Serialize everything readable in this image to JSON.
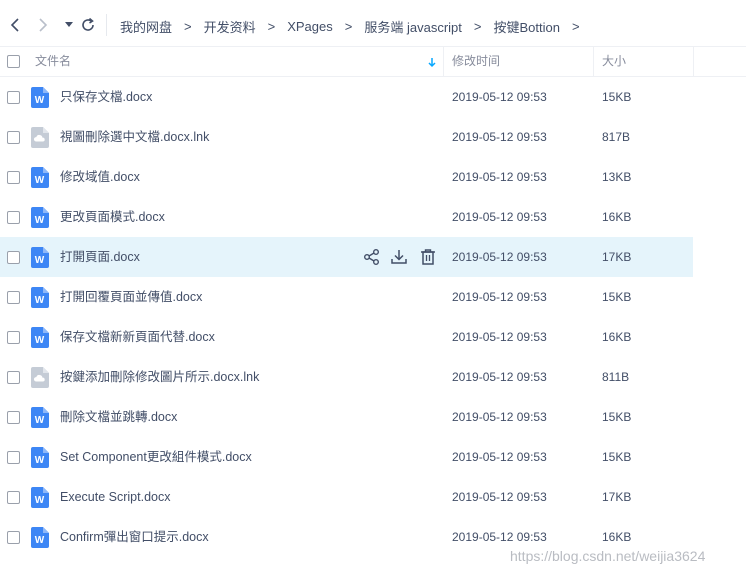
{
  "breadcrumb": {
    "items": [
      "我的网盘",
      "开发资料",
      "XPages",
      "服务端 javascript",
      "按键Bottion"
    ],
    "arrow": ">"
  },
  "table": {
    "headers": {
      "name": "文件名",
      "modified": "修改时间",
      "size": "大小"
    },
    "rows": [
      {
        "name": "只保存文檔.docx",
        "date": "2019-05-12 09:53",
        "size": "15KB",
        "icon": "word-doc-icon"
      },
      {
        "name": "視圖刪除選中文檔.docx.lnk",
        "date": "2019-05-12 09:53",
        "size": "817B",
        "icon": "cloud-file-icon"
      },
      {
        "name": "修改域值.docx",
        "date": "2019-05-12 09:53",
        "size": "13KB",
        "icon": "word-doc-icon"
      },
      {
        "name": "更改頁面模式.docx",
        "date": "2019-05-12 09:53",
        "size": "16KB",
        "icon": "word-doc-icon"
      },
      {
        "name": "打開頁面.docx",
        "date": "2019-05-12 09:53",
        "size": "17KB",
        "icon": "word-doc-icon",
        "selected": true
      },
      {
        "name": "打開回覆頁面並傳值.docx",
        "date": "2019-05-12 09:53",
        "size": "15KB",
        "icon": "word-doc-icon"
      },
      {
        "name": "保存文檔新新頁面代替.docx",
        "date": "2019-05-12 09:53",
        "size": "16KB",
        "icon": "word-doc-icon"
      },
      {
        "name": "按鍵添加刪除修改圖片所示.docx.lnk",
        "date": "2019-05-12 09:53",
        "size": "811B",
        "icon": "cloud-file-icon"
      },
      {
        "name": "刪除文檔並跳轉.docx",
        "date": "2019-05-12 09:53",
        "size": "15KB",
        "icon": "word-doc-icon"
      },
      {
        "name": "Set Component更改組件模式.docx",
        "date": "2019-05-12 09:53",
        "size": "15KB",
        "icon": "word-doc-icon"
      },
      {
        "name": "Execute Script.docx",
        "date": "2019-05-12 09:53",
        "size": "17KB",
        "icon": "word-doc-icon"
      },
      {
        "name": "Confirm彈出窗口提示.docx",
        "date": "2019-05-12 09:53",
        "size": "16KB",
        "icon": "word-doc-icon"
      }
    ]
  },
  "watermark": "https://blog.csdn.net/weijia3624",
  "colors": {
    "accent": "#06a7ff",
    "word_icon": "#3d86f5",
    "cloud_icon": "#c5ccd6",
    "selected_row": "#e5f4fb",
    "text": "#424e67",
    "header_text": "#878c9c"
  }
}
